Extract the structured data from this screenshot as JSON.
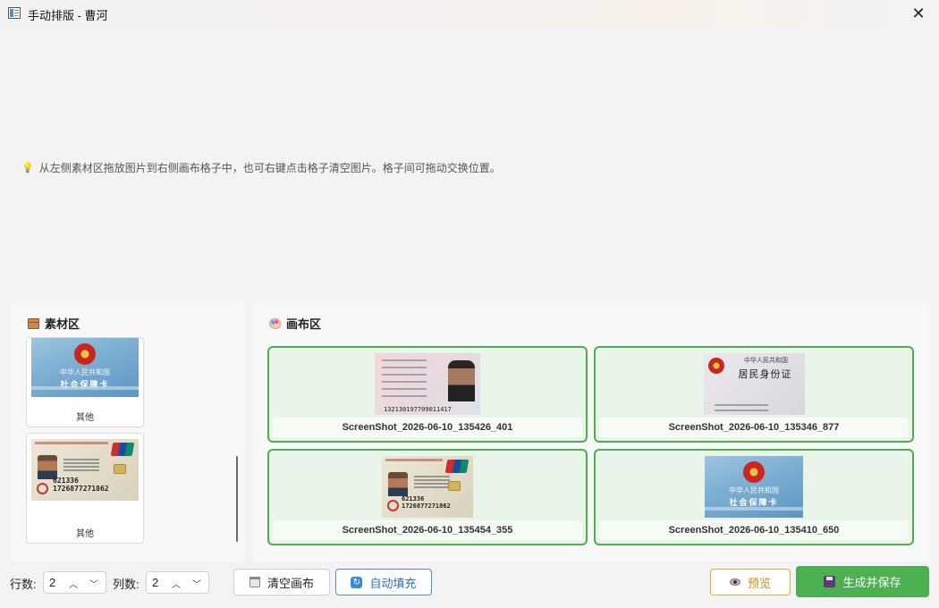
{
  "window": {
    "title": "手动排版 - 曹河",
    "close_glyph": "✕"
  },
  "hint": {
    "icon": "lightbulb-icon",
    "text": "从左侧素材区拖放图片到右侧画布格子中，也可右键点击格子清空图片。格子间可拖动交换位置。"
  },
  "material": {
    "title": "素材区",
    "icon": "box-icon",
    "items": [
      {
        "caption": "其他",
        "image": "social-security-card"
      },
      {
        "caption": "其他",
        "image": "bank-card"
      }
    ]
  },
  "canvas": {
    "title": "画布区",
    "icon": "palette-icon",
    "cells": [
      {
        "label": "ScreenShot_2026-06-10_135426_401",
        "image": "id-card-front"
      },
      {
        "label": "ScreenShot_2026-06-10_135346_877",
        "image": "id-card-back"
      },
      {
        "label": "ScreenShot_2026-06-10_135454_355",
        "image": "bank-card"
      },
      {
        "label": "ScreenShot_2026-06-10_135410_650",
        "image": "social-security-card"
      }
    ]
  },
  "card_text": {
    "social_line1": "中华人民共和国",
    "social_line2": "社会保障卡",
    "bank_number": "621336 1726877271862",
    "id_number": "132130197709011417",
    "id_back_line1": "中华人民共和国",
    "id_back_line2": "居民身份证"
  },
  "toolbar": {
    "rows_label": "行数:",
    "rows_value": "2",
    "cols_label": "列数:",
    "cols_value": "2",
    "clear_label": "清空画布",
    "autofill_label": "自动填充",
    "preview_label": "预览",
    "save_label": "生成并保存"
  },
  "colors": {
    "cell_border": "#4caf50",
    "cell_bg": "#e8f5e8",
    "save_button": "#4caf50",
    "preview_border": "#e9a83a",
    "autofill_border": "#4a8fd6"
  }
}
